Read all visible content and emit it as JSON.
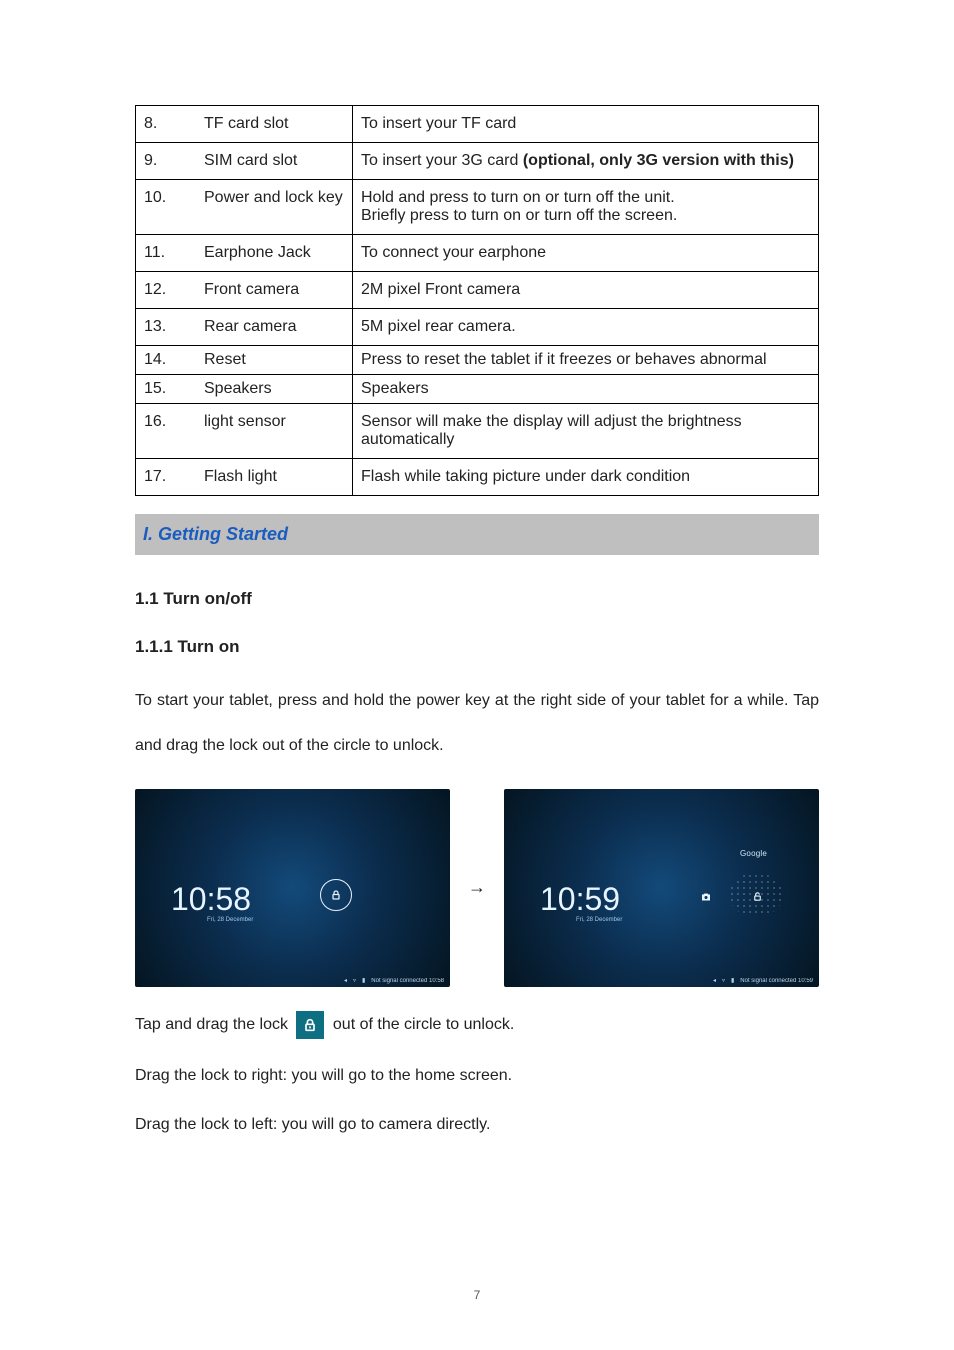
{
  "table": {
    "rows": [
      {
        "num": "8.",
        "name": "TF card slot",
        "desc": "To insert your TF card"
      },
      {
        "num": "9.",
        "name": "SIM card slot",
        "desc": "To insert your 3G card ",
        "desc_bold": "(optional, only 3G version with this)"
      },
      {
        "num": "10.",
        "name": "Power and lock key",
        "desc": "Hold and press to turn on or turn off the unit.\nBriefly press to turn on or turn off the screen."
      },
      {
        "num": "11.",
        "name": "Earphone Jack",
        "desc": "To connect your earphone"
      },
      {
        "num": "12.",
        "name": "Front camera",
        "desc": "2M pixel Front camera"
      },
      {
        "num": "13.",
        "name": "Rear camera",
        "desc": "5M pixel rear camera."
      },
      {
        "num": "14.",
        "name": "Reset",
        "desc": "Press to reset the tablet if it freezes or behaves abnormal",
        "short": true
      },
      {
        "num": "15.",
        "name": "Speakers",
        "desc": "Speakers",
        "short": true
      },
      {
        "num": "16.",
        "name": "light sensor",
        "desc": "Sensor will make the display will adjust the brightness automatically"
      },
      {
        "num": "17.",
        "name": "Flash light",
        "desc": "Flash while taking picture under dark condition"
      }
    ]
  },
  "section": {
    "title": "I. Getting Started",
    "h1": "1.1 Turn on/off",
    "h2": "1.1.1 Turn on",
    "p1": "To start your tablet, press and hold the power key at the right side of your tablet for a while. Tap and drag the lock out of the circle to unlock.",
    "p2_a": "Tap and drag the lock ",
    "p2_b": " out of the circle to unlock.",
    "p3": "Drag the lock to right: you will go to the home screen.",
    "p4": "Drag the lock to left: you will go to camera directly."
  },
  "lockscreens": {
    "arrow": "→",
    "left": {
      "time": "10:58",
      "date": "Fri, 28 December"
    },
    "right": {
      "time": "10:59",
      "date": "Fri, 28 December",
      "google": "Google"
    }
  },
  "page_number": "7"
}
